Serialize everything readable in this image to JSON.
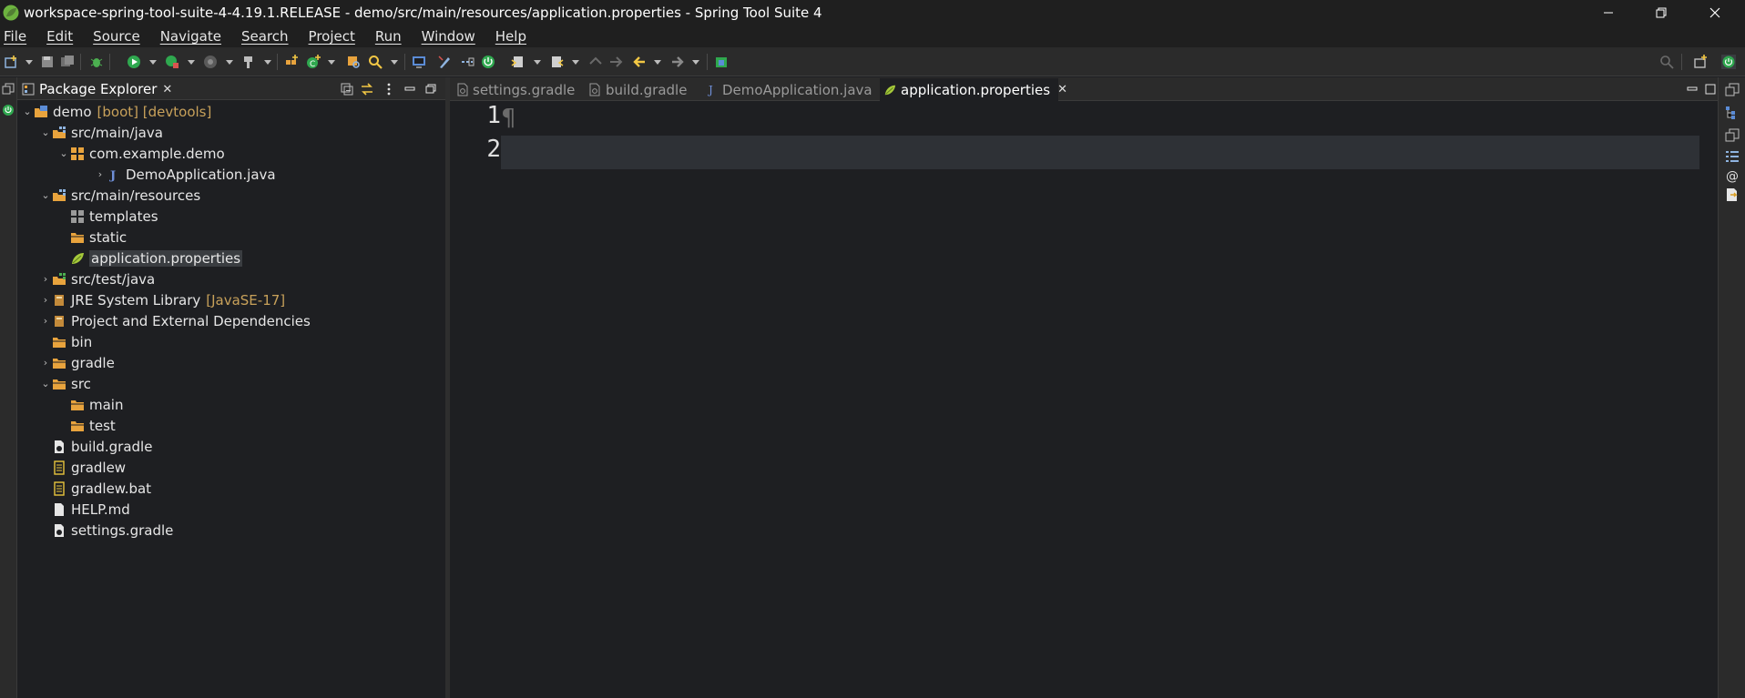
{
  "window": {
    "title": "workspace-spring-tool-suite-4-4.19.1.RELEASE - demo/src/main/resources/application.properties - Spring Tool Suite 4"
  },
  "menubar": [
    "File",
    "Edit",
    "Source",
    "Navigate",
    "Search",
    "Project",
    "Run",
    "Window",
    "Help"
  ],
  "package_explorer": {
    "title": "Package Explorer",
    "close_glyph": "✕",
    "tree": [
      {
        "label": "demo",
        "deco": "[boot] [devtools]",
        "expanded": true,
        "icon": "project-icon"
      },
      {
        "label": "src/main/java",
        "expanded": true,
        "icon": "source-folder-icon"
      },
      {
        "label": "com.example.demo",
        "expanded": true,
        "icon": "package-icon"
      },
      {
        "label": "DemoApplication.java",
        "expanded": false,
        "icon": "java-file-icon"
      },
      {
        "label": "src/main/resources",
        "expanded": true,
        "icon": "source-folder-icon"
      },
      {
        "label": "templates",
        "icon": "package-icon"
      },
      {
        "label": "static",
        "icon": "folder-icon"
      },
      {
        "label": "application.properties",
        "icon": "spring-leaf-icon",
        "selected": true
      },
      {
        "label": "src/test/java",
        "expanded": false,
        "icon": "source-folder-icon"
      },
      {
        "label": "JRE System Library",
        "deco": "[JavaSE-17]",
        "expanded": false,
        "icon": "library-icon"
      },
      {
        "label": "Project and External Dependencies",
        "expanded": false,
        "icon": "library-icon"
      },
      {
        "label": "bin",
        "icon": "folder-icon"
      },
      {
        "label": "gradle",
        "expanded": false,
        "icon": "folder-icon"
      },
      {
        "label": "src",
        "expanded": true,
        "icon": "folder-icon"
      },
      {
        "label": "main",
        "icon": "folder-icon"
      },
      {
        "label": "test",
        "icon": "folder-icon"
      },
      {
        "label": "build.gradle",
        "icon": "gradle-file-icon"
      },
      {
        "label": "gradlew",
        "icon": "text-file-icon"
      },
      {
        "label": "gradlew.bat",
        "icon": "text-file-icon"
      },
      {
        "label": "HELP.md",
        "icon": "file-icon"
      },
      {
        "label": "settings.gradle",
        "icon": "gradle-file-icon"
      }
    ]
  },
  "editor": {
    "tabs": [
      {
        "label": "settings.gradle",
        "icon": "gradle-file-icon",
        "active": false
      },
      {
        "label": "build.gradle",
        "icon": "gradle-file-icon",
        "active": false
      },
      {
        "label": "DemoApplication.java",
        "icon": "java-file-icon",
        "active": false
      },
      {
        "label": "application.properties",
        "icon": "spring-leaf-icon",
        "active": true
      }
    ],
    "close_glyph": "✕",
    "line_numbers": [
      "1",
      "2"
    ],
    "pilcrow": "¶"
  },
  "colors": {
    "background": "#1e1f22",
    "spring_green": "#6db33f",
    "folder_orange": "#e8a33d",
    "decoration": "#c8a15a"
  }
}
